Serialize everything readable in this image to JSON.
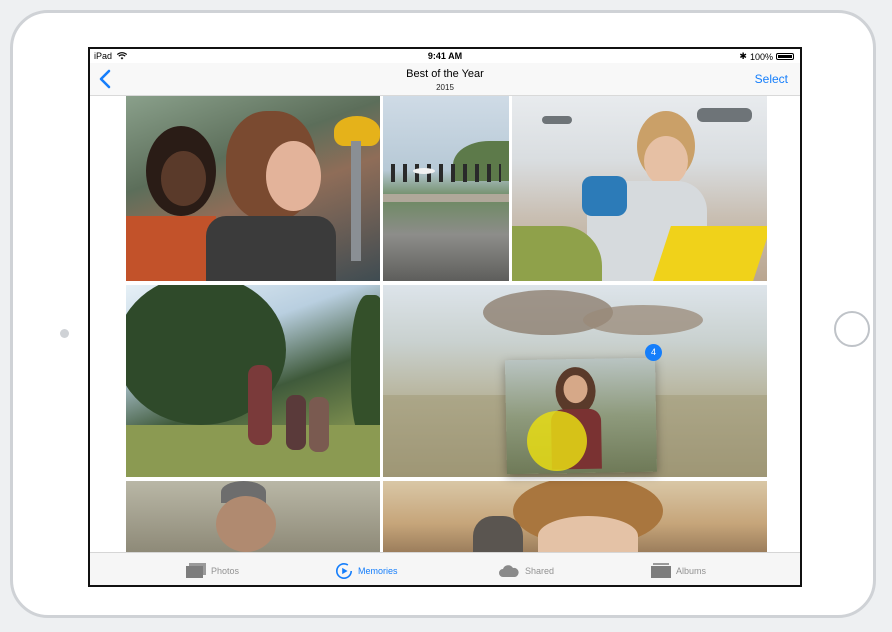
{
  "status_bar": {
    "device": "iPad",
    "time": "9:41 AM",
    "battery": "100%"
  },
  "nav": {
    "title": "Best of the Year",
    "subtitle": "2015",
    "select_label": "Select"
  },
  "drag": {
    "count": "4"
  },
  "tabs": [
    {
      "label": "Photos",
      "icon": "photos-icon"
    },
    {
      "label": "Memories",
      "icon": "memories-icon"
    },
    {
      "label": "Shared",
      "icon": "cloud-icon"
    },
    {
      "label": "Albums",
      "icon": "albums-icon"
    }
  ],
  "colors": {
    "accent": "#157efb",
    "touch_indicator": "#e6dc14"
  }
}
